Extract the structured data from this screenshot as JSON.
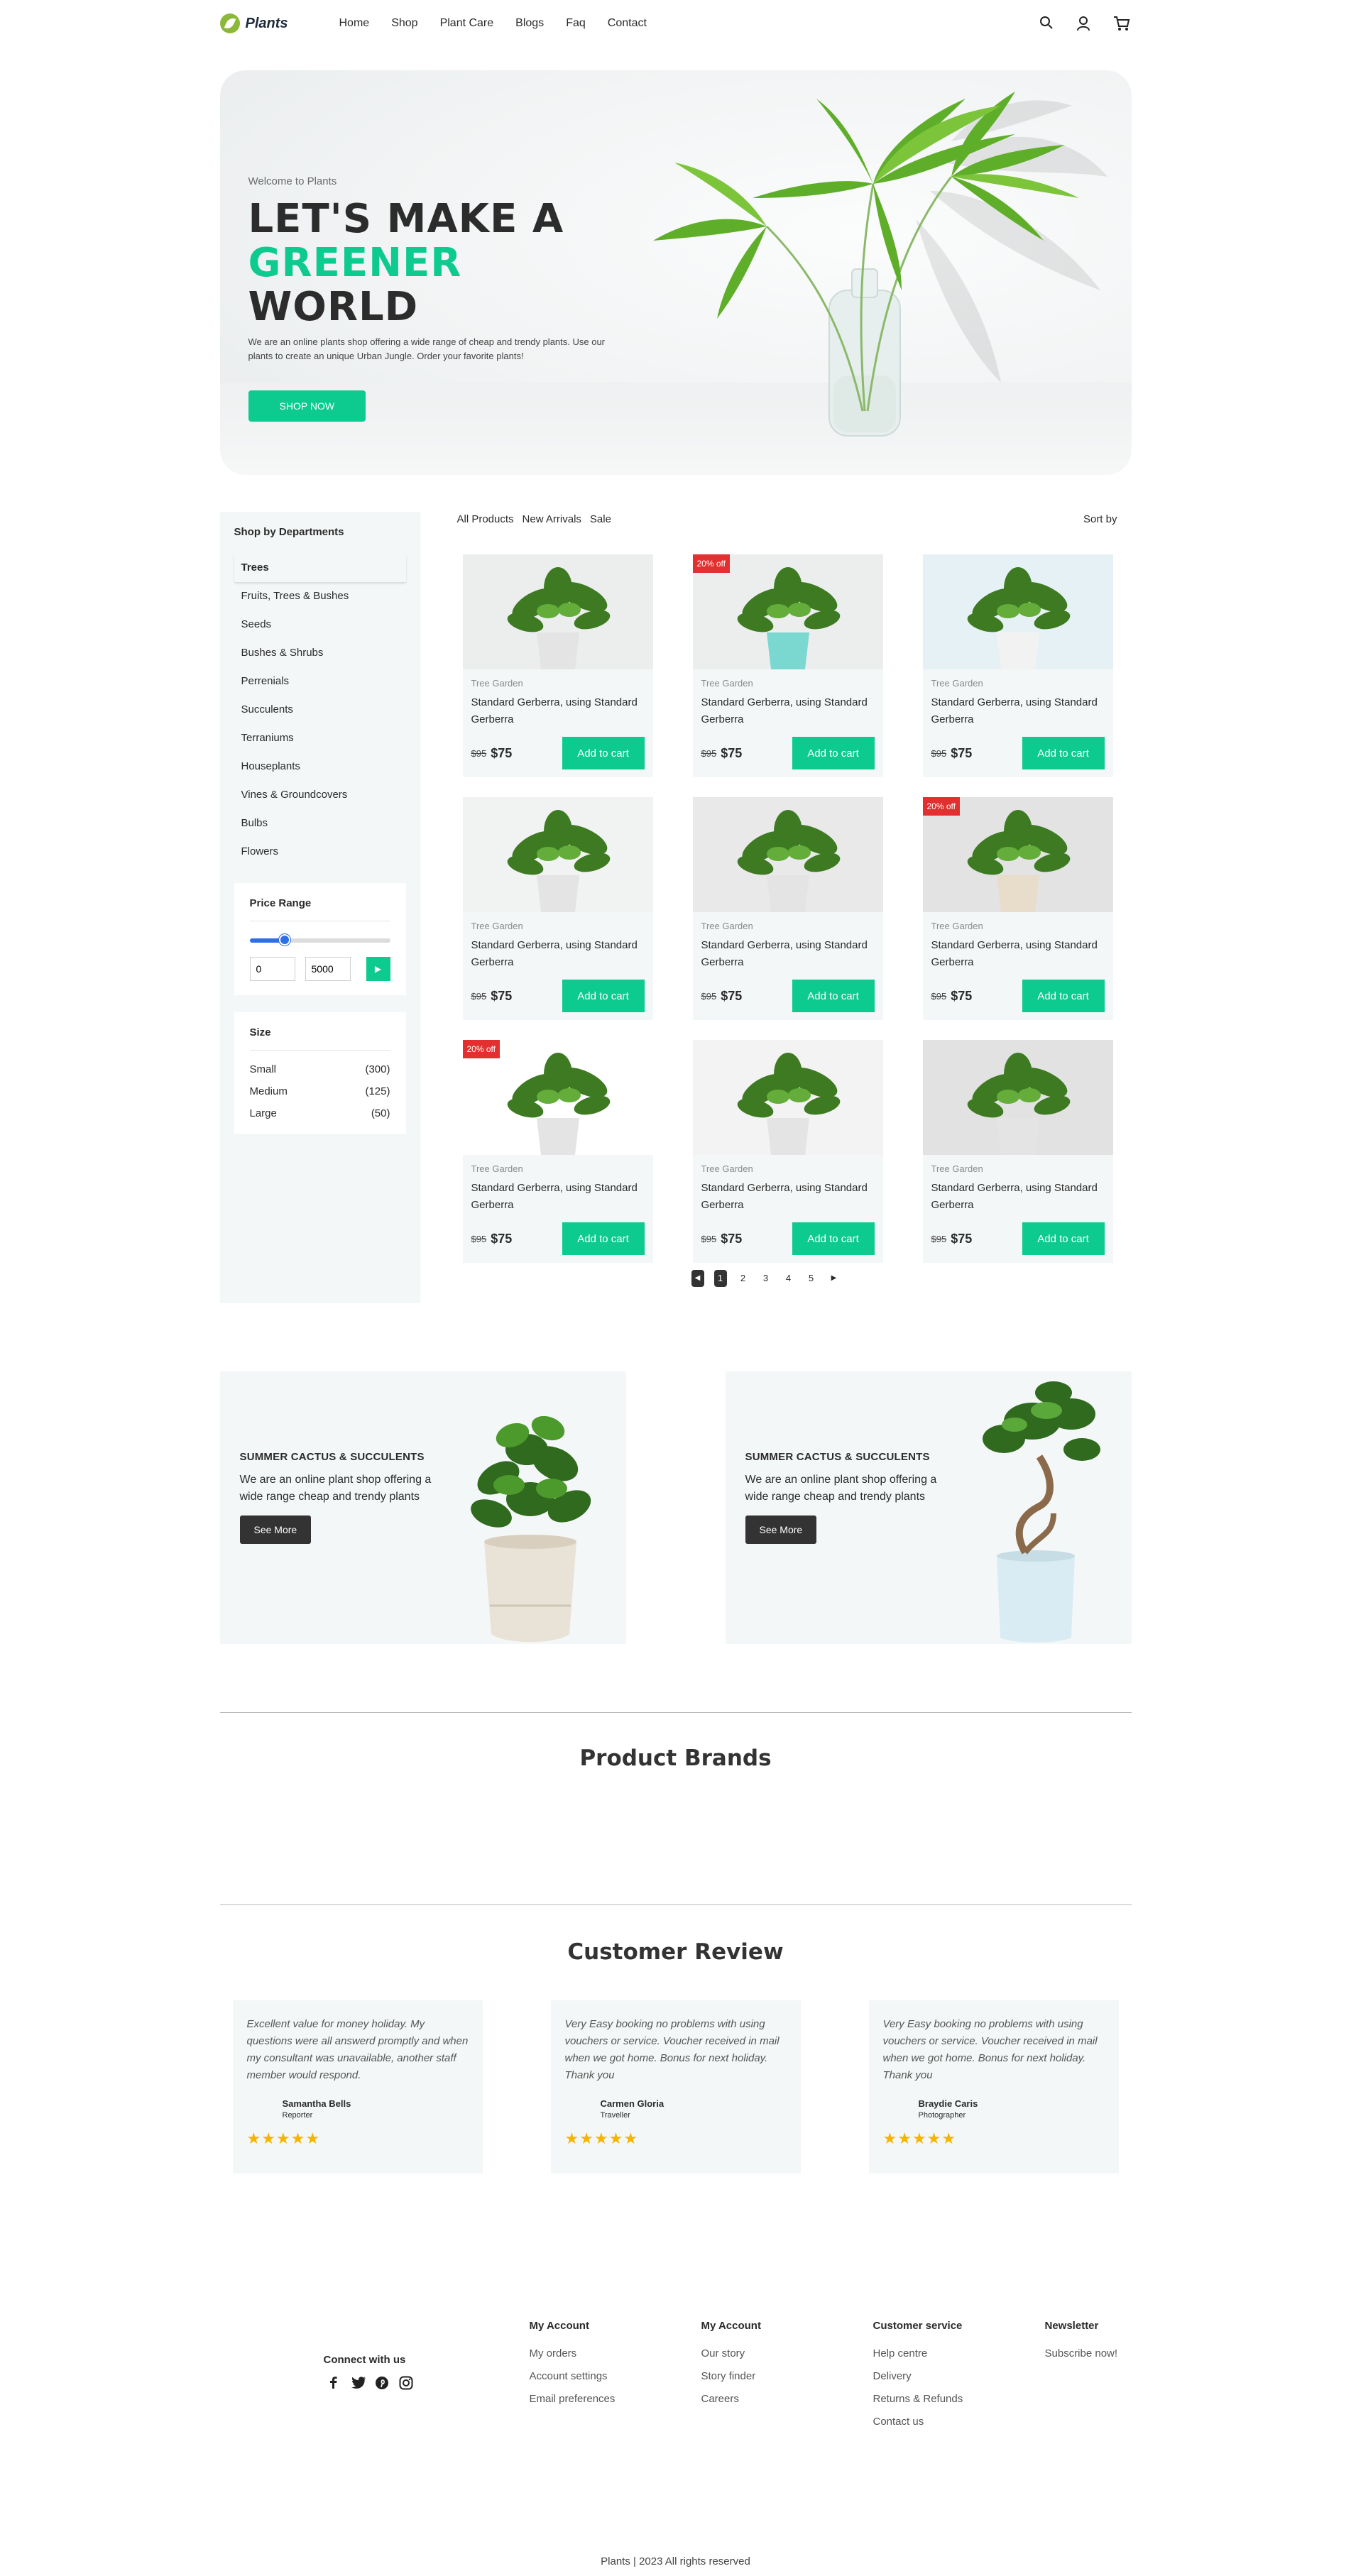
{
  "brand": {
    "name": "Plants"
  },
  "nav": [
    {
      "label": "Home"
    },
    {
      "label": "Shop"
    },
    {
      "label": "Plant Care"
    },
    {
      "label": "Blogs"
    },
    {
      "label": "Faq"
    },
    {
      "label": "Contact"
    }
  ],
  "header_icons": [
    "search-icon",
    "user-icon",
    "cart-icon"
  ],
  "hero": {
    "welcome": "Welcome to Plants",
    "title_line1": "LET'S MAKE A",
    "title_green": "GREENER",
    "title_rest": " WORLD",
    "desc": "We are an online plants shop offering a wide range of cheap and trendy plants. Use our plants to create an unique Urban Jungle. Order your favorite plants!",
    "cta": "SHOP NOW"
  },
  "sidebar": {
    "title": "Shop by Departments",
    "departments": [
      {
        "label": "Trees",
        "active": true
      },
      {
        "label": "Fruits, Trees & Bushes"
      },
      {
        "label": "Seeds"
      },
      {
        "label": "Bushes & Shrubs"
      },
      {
        "label": "Perrenials"
      },
      {
        "label": "Succulents"
      },
      {
        "label": "Terraniums"
      },
      {
        "label": "Houseplants"
      },
      {
        "label": "Vines & Groundcovers"
      },
      {
        "label": "Bulbs"
      },
      {
        "label": "Flowers"
      }
    ],
    "price_range": {
      "title": "Price Range",
      "min": "0",
      "max": "5000",
      "slider_level": 0.25
    },
    "size": {
      "title": "Size",
      "options": [
        {
          "label": "Small",
          "count": "(300)"
        },
        {
          "label": "Medium",
          "count": "(125)"
        },
        {
          "label": "Large",
          "count": "(50)"
        }
      ]
    }
  },
  "product_tabs": [
    "All Products",
    "New Arrivals",
    "Sale"
  ],
  "sort_label": "Sort by",
  "products": [
    {
      "brand": "Tree Garden",
      "title": "Standard Gerberra, using Standard Gerberra",
      "old_price": "$95",
      "price": "$75",
      "cta": "Add to cart",
      "badge": ""
    },
    {
      "brand": "Tree Garden",
      "title": "Standard Gerberra, using Standard Gerberra",
      "old_price": "$95",
      "price": "$75",
      "cta": "Add to cart",
      "badge": "20% off"
    },
    {
      "brand": "Tree Garden",
      "title": "Standard Gerberra, using Standard Gerberra",
      "old_price": "$95",
      "price": "$75",
      "cta": "Add to cart",
      "badge": ""
    },
    {
      "brand": "Tree Garden",
      "title": "Standard Gerberra, using Standard Gerberra",
      "old_price": "$95",
      "price": "$75",
      "cta": "Add to cart",
      "badge": ""
    },
    {
      "brand": "Tree Garden",
      "title": "Standard Gerberra, using Standard Gerberra",
      "old_price": "$95",
      "price": "$75",
      "cta": "Add to cart",
      "badge": ""
    },
    {
      "brand": "Tree Garden",
      "title": "Standard Gerberra, using Standard Gerberra",
      "old_price": "$95",
      "price": "$75",
      "cta": "Add to cart",
      "badge": "20% off"
    },
    {
      "brand": "Tree Garden",
      "title": "Standard Gerberra, using Standard Gerberra",
      "old_price": "$95",
      "price": "$75",
      "cta": "Add to cart",
      "badge": "20% off"
    },
    {
      "brand": "Tree Garden",
      "title": "Standard Gerberra, using Standard Gerberra",
      "old_price": "$95",
      "price": "$75",
      "cta": "Add to cart",
      "badge": ""
    },
    {
      "brand": "Tree Garden",
      "title": "Standard Gerberra, using Standard Gerberra",
      "old_price": "$95",
      "price": "$75",
      "cta": "Add to cart",
      "badge": ""
    }
  ],
  "pagination": {
    "pages": [
      "1",
      "2",
      "3",
      "4",
      "5"
    ],
    "current": "1",
    "prev": "◀",
    "next": "▶"
  },
  "promos": [
    {
      "title": "SUMMER CACTUS & SUCCULENTS",
      "desc": "We are an online plant shop offering a wide range cheap and trendy plants",
      "cta": "See More"
    },
    {
      "title": "SUMMER CACTUS & SUCCULENTS",
      "desc": "We are an online plant shop offering a wide range cheap and trendy plants",
      "cta": "See More"
    }
  ],
  "brands_title": "Product Brands",
  "reviews_title": "Customer Review",
  "reviews": [
    {
      "text": "Excellent value for money holiday. My questions were all answerd promptly and when my consultant was unavailable, another staff member would respond.",
      "name": "Samantha Bells",
      "role": "Reporter",
      "stars": "★★★★★"
    },
    {
      "text": "Very Easy booking no problems with using vouchers or service. Voucher received in mail when we got home. Bonus for next holiday. Thank you",
      "name": "Carmen Gloria",
      "role": "Traveller",
      "stars": "★★★★★"
    },
    {
      "text": "Very Easy booking no problems with using vouchers or service. Voucher received in mail when we got home. Bonus for next holiday. Thank you",
      "name": "Braydie Caris",
      "role": "Photographer",
      "stars": "★★★★★"
    }
  ],
  "footer": {
    "connect_title": "Connect with us",
    "social": [
      "facebook-icon",
      "twitter-icon",
      "pinterest-icon",
      "instagram-icon"
    ],
    "columns": [
      {
        "title": "My Account",
        "links": [
          "My orders",
          "Account settings",
          "Email preferences"
        ]
      },
      {
        "title": "My Account",
        "links": [
          "Our story",
          "Story finder",
          "Careers"
        ]
      },
      {
        "title": "Customer service",
        "links": [
          "Help centre",
          "Delivery",
          "Returns & Refunds",
          "Contact us"
        ]
      },
      {
        "title": "Newsletter",
        "links": [
          "Subscribe now!"
        ]
      }
    ],
    "copyright": "Plants | 2023 All rights reserved"
  },
  "colors": {
    "accent": "#0dca8e",
    "badge": "#e23030",
    "panel": "#f4f7f7",
    "dark": "#333333",
    "star": "#f4b400"
  }
}
